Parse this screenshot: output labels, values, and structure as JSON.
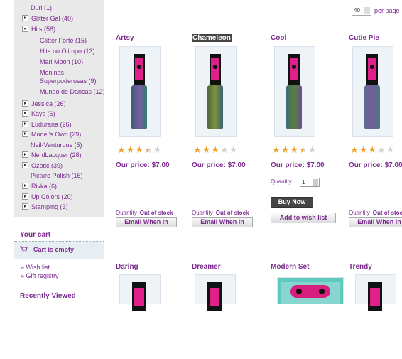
{
  "categories": [
    {
      "label": "Duri (1)",
      "toggle": false
    },
    {
      "label": "Glitter Gal (40)",
      "toggle": true
    },
    {
      "label": "Hits (58)",
      "toggle": true,
      "open": true
    },
    {
      "label": "Jessica (26)",
      "toggle": true
    },
    {
      "label": "Kays (6)",
      "toggle": true
    },
    {
      "label": "Ludurana (26)",
      "toggle": true
    },
    {
      "label": "Model's Own (29)",
      "toggle": true
    },
    {
      "label": "Nail-Venturous (5)",
      "toggle": false
    },
    {
      "label": "NerdLacquer (28)",
      "toggle": true
    },
    {
      "label": "Ozotic (39)",
      "toggle": true
    },
    {
      "label": "Picture Polish (16)",
      "toggle": false
    },
    {
      "label": "Rivka (6)",
      "toggle": true
    },
    {
      "label": "Up Colors (20)",
      "toggle": true
    },
    {
      "label": "Stamping (3)",
      "toggle": true
    }
  ],
  "subcategories": [
    "Glitter Forte (15)",
    "Hits no Olimpo (13)",
    "Mari Moon (10)",
    "Meninas Superpoderosas (9)",
    "Mundo de Dancas (12)"
  ],
  "cart": {
    "title": "Your cart",
    "empty": "Cart is empty"
  },
  "links": {
    "wishlist": "Wish list",
    "registry": "Gift registry"
  },
  "recently_viewed": "Recently Viewed",
  "perpage": {
    "value": "40",
    "label": "per page"
  },
  "colors": {
    "accent": "#7a2a8f",
    "star": "#f0a020"
  },
  "products": [
    {
      "name": "Artsy",
      "rating": 3.5,
      "price": "Our price: $7.00",
      "qty_label": "Quantity",
      "stock": "Out of stock",
      "button": "Email When In"
    },
    {
      "name": "Chameleon",
      "rating": 3,
      "price": "Our price: $7.00",
      "qty_label": "Quantity",
      "stock": "Out of stock",
      "button": "Email When In"
    },
    {
      "name": "Cool",
      "rating": 3.5,
      "price": "Our price: $7.00",
      "qty_label": "Quantity",
      "qty_value": "1",
      "buy": "Buy Now",
      "button": "Add to wish list"
    },
    {
      "name": "Cutie Pie",
      "rating": 3,
      "price": "Our price: $7.00",
      "qty_label": "Quantity",
      "stock": "Out of stock",
      "button": "Email When In"
    }
  ],
  "row2": [
    "Daring",
    "Dreamer",
    "Modern Set",
    "Trendy"
  ]
}
